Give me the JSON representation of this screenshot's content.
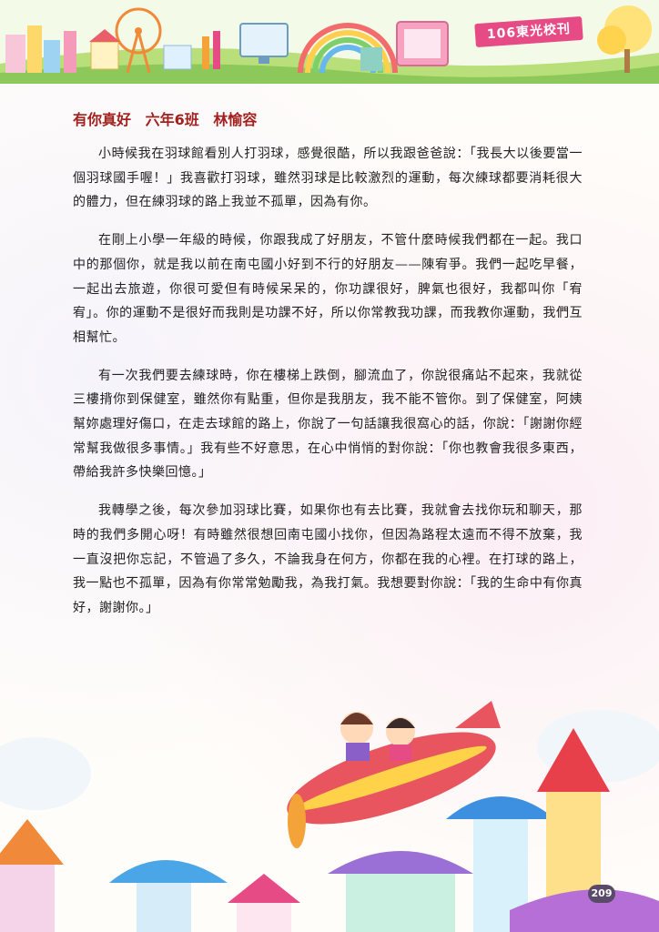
{
  "header": {
    "tag": "106東光校刊"
  },
  "article": {
    "title": "有你真好",
    "class_label": "六年6班",
    "author": "林愉容",
    "paragraphs": [
      "小時候我在羽球館看別人打羽球，感覺很酷，所以我跟爸爸說：「我長大以後要當一個羽球國手喔！」我喜歡打羽球，雖然羽球是比較激烈的運動，每次練球都要消耗很大的體力，但在練羽球的路上我並不孤單，因為有你。",
      "在剛上小學一年級的時候，你跟我成了好朋友，不管什麼時候我們都在一起。我口中的那個你，就是我以前在南屯國小好到不行的好朋友——陳宥爭。我們一起吃早餐，一起出去旅遊，你很可愛但有時候呆呆的，你功課很好，脾氣也很好，我都叫你「宥宥」。你的運動不是很好而我則是功課不好，所以你常教我功課，而我教你運動，我們互相幫忙。",
      "有一次我們要去練球時，你在樓梯上跌倒，腳流血了，你說很痛站不起來，我就從三樓揹你到保健室，雖然你有點重，但你是我朋友，我不能不管你。到了保健室，阿姨幫妳處理好傷口，在走去球館的路上，你說了一句話讓我很窩心的話，你說：「謝謝你經常幫我做很多事情。」我有些不好意思，在心中悄悄的對你說：「你也教會我很多東西，帶給我許多快樂回憶。」",
      "我轉學之後，每次參加羽球比賽，如果你也有去比賽，我就會去找你玩和聊天，那時的我們多開心呀！有時雖然很想回南屯國小找你，但因為路程太遠而不得不放棄，我一直沒把你忘記，不管過了多久，不論我身在何方，你都在我的心裡。在打球的路上，我一點也不孤單，因為有你常常勉勵我，為我打氣。我想要對你說：「我的生命中有你真好，謝謝你。」"
    ]
  },
  "footer": {
    "page_number": "209"
  },
  "colors": {
    "title": "#a2211f",
    "tag_bg": "#e64b86",
    "text": "#222222"
  }
}
